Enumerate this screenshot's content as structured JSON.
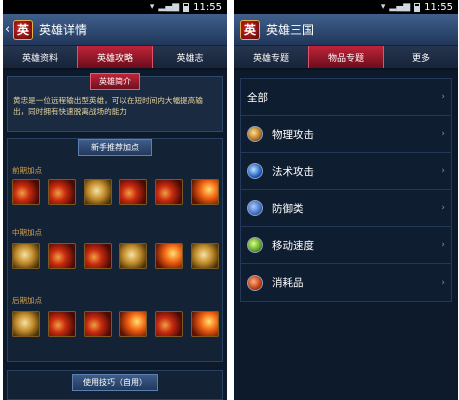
{
  "left": {
    "status_time": "11:55",
    "title": "英雄详情",
    "logo_char": "英",
    "tabs": [
      "英雄资料",
      "英雄攻略",
      "英雄志"
    ],
    "active_tab": 1,
    "intro_tag": "英雄简介",
    "intro_text": "黄忠是一位远程输出型英雄，可以在短时间内大幅提高输出，同时拥有快速脱离战场的能力",
    "guide_tag": "新手推荐加点",
    "stages": [
      "前期加点",
      "中期加点",
      "后期加点"
    ],
    "bottom_tag": "使用技巧（自用）"
  },
  "right": {
    "status_time": "11:55",
    "title": "英雄三国",
    "logo_char": "英",
    "tabs": [
      "英雄专题",
      "物品专题",
      "更多"
    ],
    "active_tab": 1,
    "items": [
      {
        "label": "全部",
        "icon": "none"
      },
      {
        "label": "物理攻击",
        "icon": "sword-icon"
      },
      {
        "label": "法术攻击",
        "icon": "magic-icon"
      },
      {
        "label": "防御类",
        "icon": "shield-icon"
      },
      {
        "label": "移动速度",
        "icon": "boots-icon"
      },
      {
        "label": "消耗品",
        "icon": "potion-icon"
      }
    ]
  }
}
